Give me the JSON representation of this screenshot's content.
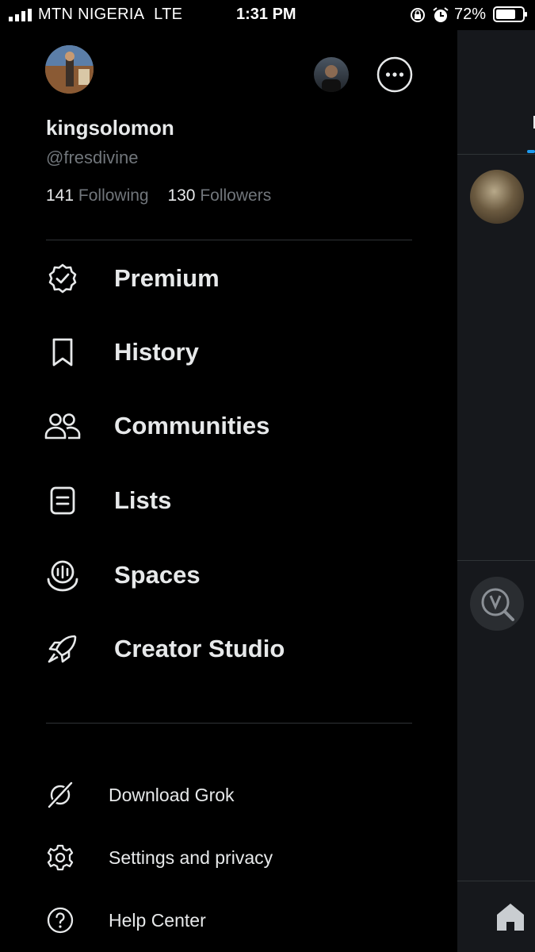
{
  "status_bar": {
    "carrier": "MTN NIGERIA",
    "network": "LTE",
    "time": "1:31 PM",
    "battery": "72%"
  },
  "profile": {
    "display_name": "kingsolomon",
    "handle": "@fresdivine",
    "following_count": "141",
    "following_label": "Following",
    "followers_count": "130",
    "followers_label": "Followers"
  },
  "menu": [
    {
      "label": "Premium",
      "icon": "verified-badge-icon"
    },
    {
      "label": "History",
      "icon": "bookmark-icon"
    },
    {
      "label": "Communities",
      "icon": "people-icon"
    },
    {
      "label": "Lists",
      "icon": "list-icon"
    },
    {
      "label": "Spaces",
      "icon": "microphone-icon"
    },
    {
      "label": "Creator Studio",
      "icon": "rocket-icon"
    }
  ],
  "secondary_menu": [
    {
      "label": "Download Grok",
      "icon": "grok-icon"
    },
    {
      "label": "Settings and privacy",
      "icon": "gear-icon"
    },
    {
      "label": "Help Center",
      "icon": "question-icon"
    }
  ],
  "colors": {
    "background": "#000000",
    "text_primary": "#e7e9ea",
    "text_secondary": "#71767b",
    "divider": "#2f3336",
    "accent": "#1d9bf0"
  }
}
